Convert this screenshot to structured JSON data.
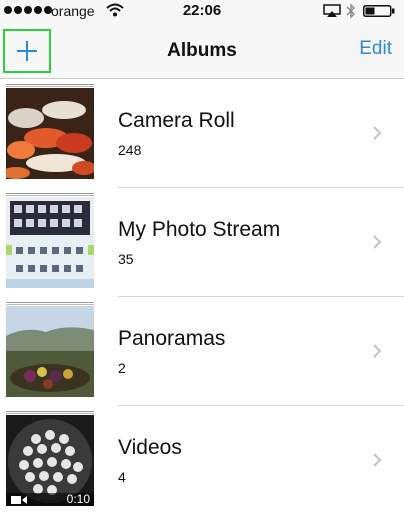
{
  "status_bar": {
    "carrier": "orange",
    "time": "22:06",
    "icons": [
      "signal-dots-icon",
      "wifi-icon",
      "airplay-icon",
      "bluetooth-icon",
      "battery-icon"
    ]
  },
  "nav": {
    "title": "Albums",
    "left_button_icon": "plus-icon",
    "right_button_label": "Edit"
  },
  "albums": [
    {
      "title": "Camera Roll",
      "count": "248"
    },
    {
      "title": "My Photo Stream",
      "count": "35"
    },
    {
      "title": "Panoramas",
      "count": "2"
    },
    {
      "title": "Videos",
      "count": "4"
    }
  ],
  "videos_thumb": {
    "duration": "0:10"
  },
  "colors": {
    "accent": "#2a8bd9",
    "highlight": "#2ecc40",
    "bar_bg": "#f7f7f7"
  }
}
